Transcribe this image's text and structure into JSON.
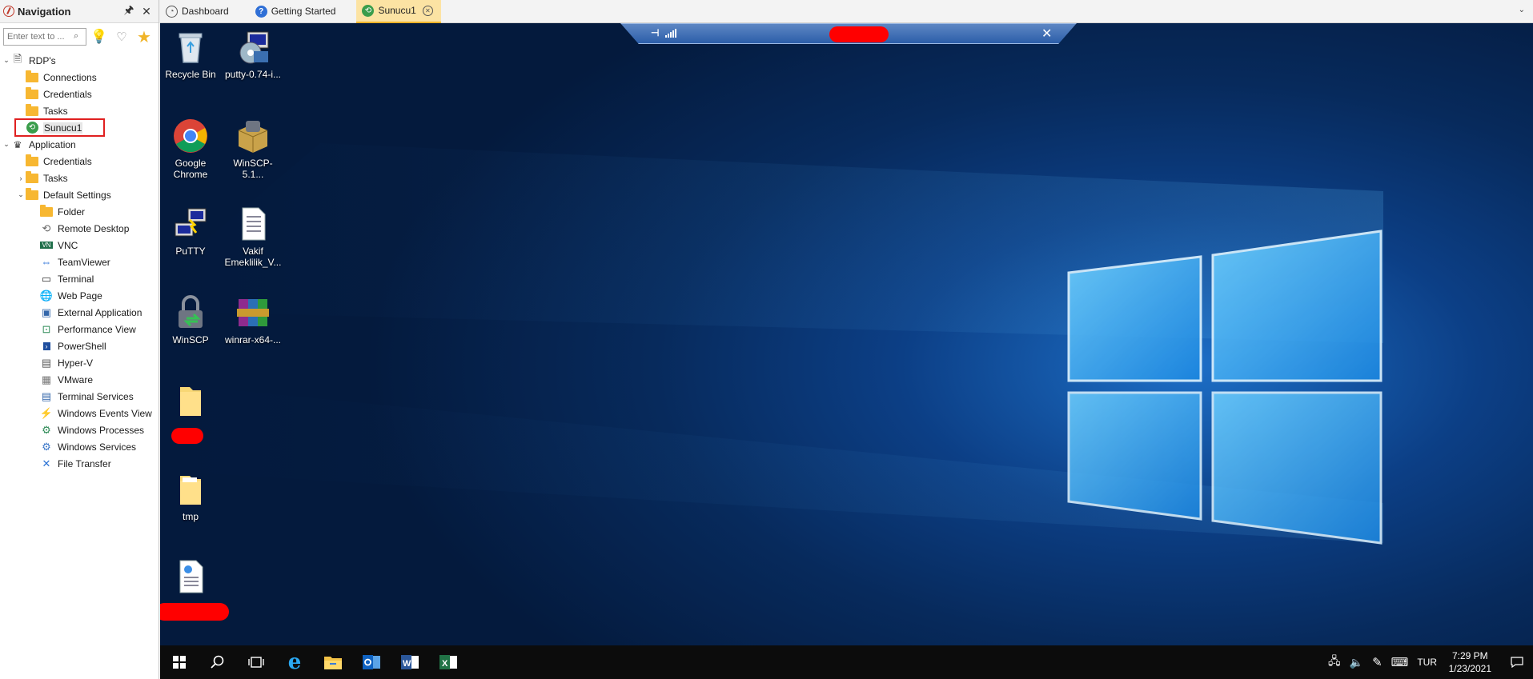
{
  "nav": {
    "title": "Navigation",
    "pin_glyph": "🖈",
    "close_glyph": "✕",
    "search_placeholder": "Enter text to ...",
    "tree": [
      {
        "label": "RDP's",
        "level": 0,
        "twisty": "⌄",
        "icon": "rdp-root-icon"
      },
      {
        "label": "Connections",
        "level": 1,
        "twisty": "",
        "icon": "folder-icon"
      },
      {
        "label": "Credentials",
        "level": 1,
        "twisty": "",
        "icon": "folder-icon"
      },
      {
        "label": "Tasks",
        "level": 1,
        "twisty": "",
        "icon": "folder-icon"
      },
      {
        "label": "Sunucu1",
        "level": 1,
        "twisty": "",
        "icon": "rdp-connection-icon",
        "selected": true
      },
      {
        "label": "Application",
        "level": 0,
        "twisty": "⌄",
        "icon": "crown-icon"
      },
      {
        "label": "Credentials",
        "level": 1,
        "twisty": "",
        "icon": "folder-icon"
      },
      {
        "label": "Tasks",
        "level": 1,
        "twisty": "›",
        "icon": "folder-icon"
      },
      {
        "label": "Default Settings",
        "level": 1,
        "twisty": "⌄",
        "icon": "folder-icon"
      },
      {
        "label": "Folder",
        "level": 2,
        "twisty": "",
        "icon": "folder-icon"
      },
      {
        "label": "Remote Desktop",
        "level": 2,
        "twisty": "",
        "icon": "remote-desktop-icon"
      },
      {
        "label": "VNC",
        "level": 2,
        "twisty": "",
        "icon": "vnc-icon"
      },
      {
        "label": "TeamViewer",
        "level": 2,
        "twisty": "",
        "icon": "teamviewer-icon"
      },
      {
        "label": "Terminal",
        "level": 2,
        "twisty": "",
        "icon": "terminal-icon"
      },
      {
        "label": "Web Page",
        "level": 2,
        "twisty": "",
        "icon": "globe-icon"
      },
      {
        "label": "External Application",
        "level": 2,
        "twisty": "",
        "icon": "window-icon"
      },
      {
        "label": "Performance View",
        "level": 2,
        "twisty": "",
        "icon": "performance-icon"
      },
      {
        "label": "PowerShell",
        "level": 2,
        "twisty": "",
        "icon": "powershell-icon"
      },
      {
        "label": "Hyper-V",
        "level": 2,
        "twisty": "",
        "icon": "hyperv-icon"
      },
      {
        "label": "VMware",
        "level": 2,
        "twisty": "",
        "icon": "vmware-icon"
      },
      {
        "label": "Terminal Services",
        "level": 2,
        "twisty": "",
        "icon": "terminal-services-icon"
      },
      {
        "label": "Windows Events View",
        "level": 2,
        "twisty": "",
        "icon": "events-icon"
      },
      {
        "label": "Windows Processes",
        "level": 2,
        "twisty": "",
        "icon": "processes-icon"
      },
      {
        "label": "Windows Services",
        "level": 2,
        "twisty": "",
        "icon": "services-icon"
      },
      {
        "label": "File Transfer",
        "level": 2,
        "twisty": "",
        "icon": "file-transfer-icon"
      }
    ]
  },
  "tabs": [
    {
      "label": "Dashboard",
      "icon": "dashboard-icon",
      "active": false
    },
    {
      "label": "Getting Started",
      "icon": "help-icon",
      "active": false
    },
    {
      "label": "Sunucu1",
      "icon": "rdp-connection-icon",
      "active": true
    }
  ],
  "desktop_icons": [
    {
      "label": "Recycle Bin",
      "icon": "recycle-bin-icon"
    },
    {
      "label": "putty-0.74-i...",
      "icon": "installer-icon"
    },
    {
      "label": "Google Chrome",
      "icon": "chrome-icon"
    },
    {
      "label": "WinSCP-5.1...",
      "icon": "package-icon"
    },
    {
      "label": "PuTTY",
      "icon": "putty-icon"
    },
    {
      "label": "Vakif Emeklilik_V...",
      "icon": "document-icon"
    },
    {
      "label": "WinSCP",
      "icon": "winscp-icon"
    },
    {
      "label": "winrar-x64-...",
      "icon": "winrar-icon"
    },
    {
      "label": "",
      "icon": "folder-icon"
    },
    {
      "label": "tmp",
      "icon": "folder-icon"
    },
    {
      "label": "",
      "icon": "web-document-icon"
    }
  ],
  "taskbar": {
    "apps": [
      "windows-start-icon",
      "search-icon",
      "task-view-icon",
      "internet-explorer-icon",
      "file-explorer-icon",
      "outlook-icon",
      "word-icon",
      "excel-icon"
    ],
    "language": "TUR",
    "time": "7:29 PM",
    "date": "1/23/2021"
  },
  "colors": {
    "accent_tab": "#fce3a3",
    "selection_box": "#e02020",
    "redaction": "#ff0000",
    "taskbar": "#0c0c0c"
  }
}
